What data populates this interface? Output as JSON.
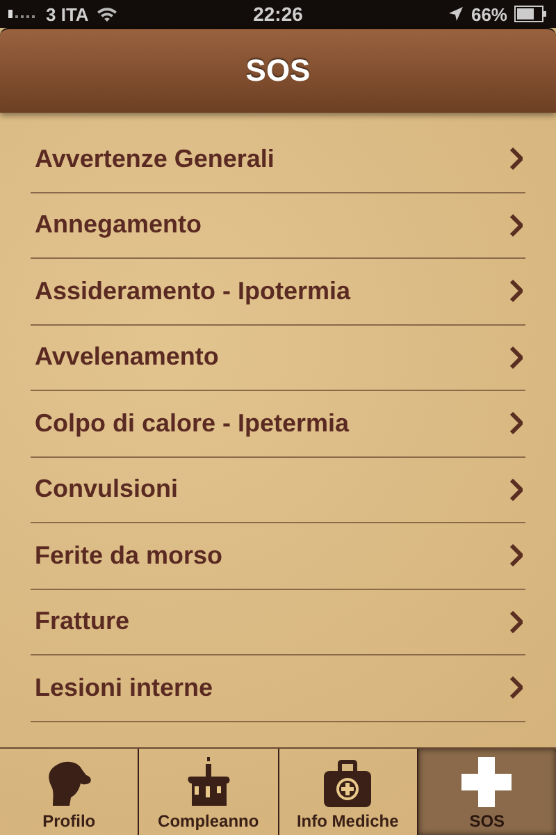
{
  "status_bar": {
    "carrier": "3 ITA",
    "time": "22:26",
    "battery": "66%"
  },
  "nav_bar": {
    "title": "SOS"
  },
  "items": [
    {
      "label": "Avvertenze Generali"
    },
    {
      "label": "Annegamento"
    },
    {
      "label": "Assideramento - Ipotermia"
    },
    {
      "label": "Avvelenamento"
    },
    {
      "label": "Colpo di calore - Ipetermia"
    },
    {
      "label": "Convulsioni"
    },
    {
      "label": "Ferite da morso"
    },
    {
      "label": "Fratture"
    },
    {
      "label": "Lesioni interne"
    }
  ],
  "tabs": [
    {
      "label": "Profilo",
      "kind": "dog",
      "selected": false
    },
    {
      "label": "Compleanno",
      "kind": "cake",
      "selected": false
    },
    {
      "label": "Info Mediche",
      "kind": "kit",
      "selected": false
    },
    {
      "label": "SOS",
      "kind": "cross",
      "selected": true
    }
  ]
}
